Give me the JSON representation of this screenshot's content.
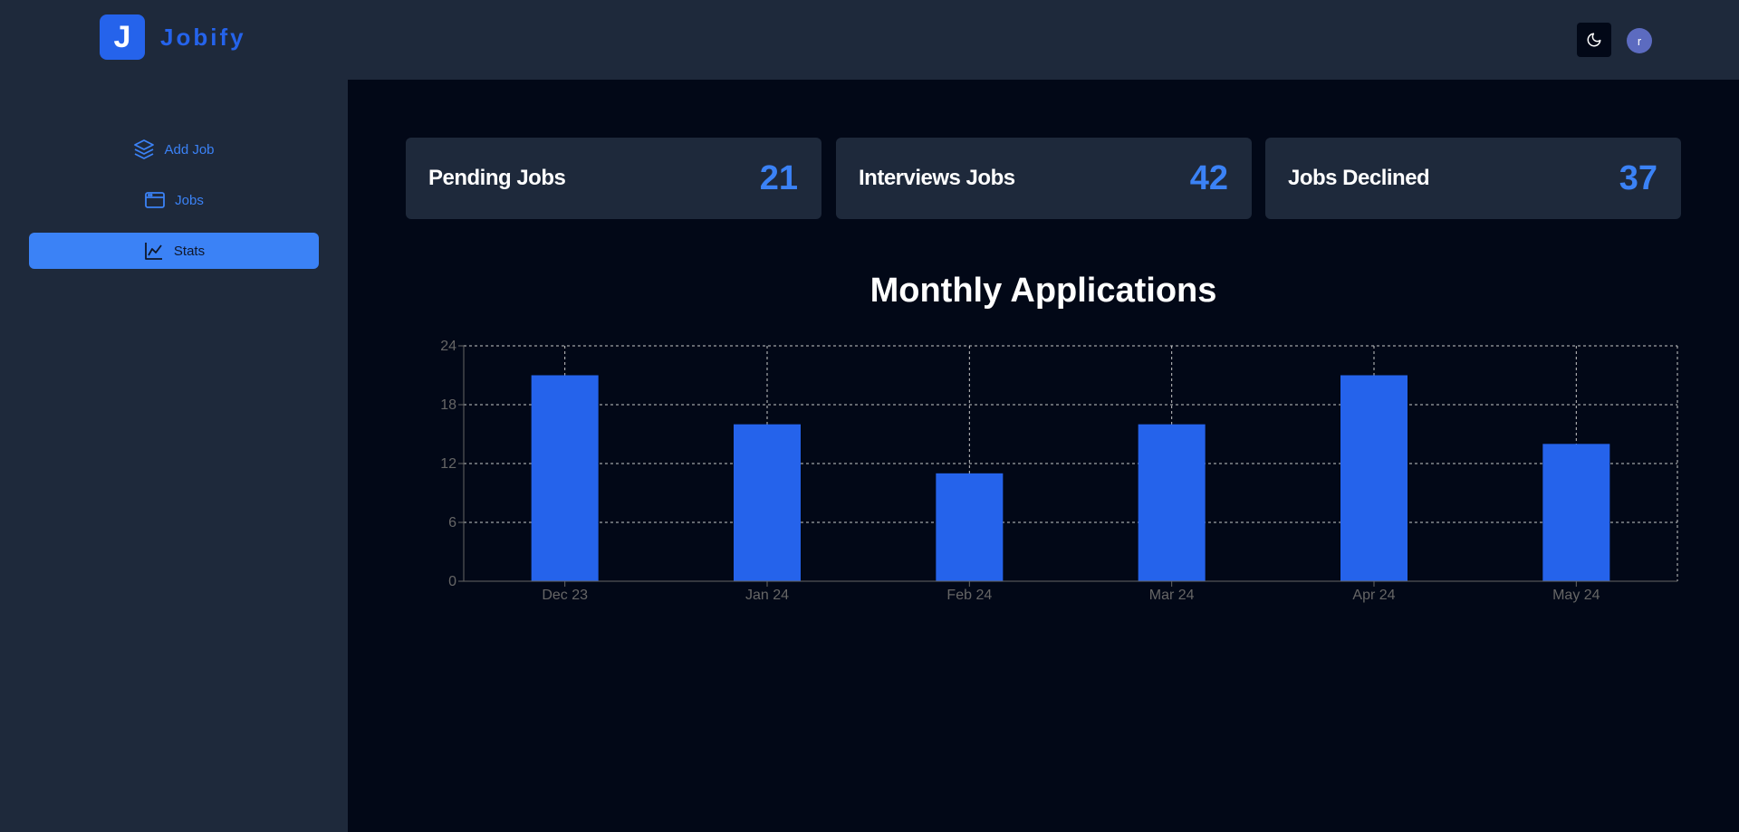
{
  "brand": {
    "logo_letter": "J",
    "name": "Jobify",
    "color": "#2563eb"
  },
  "sidebar": {
    "items": [
      {
        "label": "Add Job",
        "icon": "layers-icon"
      },
      {
        "label": "Jobs",
        "icon": "browser-window-icon"
      },
      {
        "label": "Stats",
        "icon": "line-chart-icon",
        "active": true
      }
    ]
  },
  "header": {
    "theme_toggle_icon": "moon-icon",
    "avatar_initial": "r"
  },
  "stats": [
    {
      "title": "Pending Jobs",
      "value": "21"
    },
    {
      "title": "Interviews Jobs",
      "value": "42"
    },
    {
      "title": "Jobs Declined",
      "value": "37"
    }
  ],
  "chart_title": "Monthly Applications",
  "chart_data": {
    "type": "bar",
    "categories": [
      "Dec 23",
      "Jan 24",
      "Feb 24",
      "Mar 24",
      "Apr 24",
      "May 24"
    ],
    "values": [
      21,
      16,
      11,
      16,
      21,
      14
    ],
    "ylim": [
      0,
      24
    ],
    "yticks": [
      0,
      6,
      12,
      18,
      24
    ],
    "grid": true,
    "bar_color": "#2563eb"
  },
  "colors": {
    "accent": "#3b82f6",
    "background": "#020817",
    "panel": "#1e293b"
  }
}
